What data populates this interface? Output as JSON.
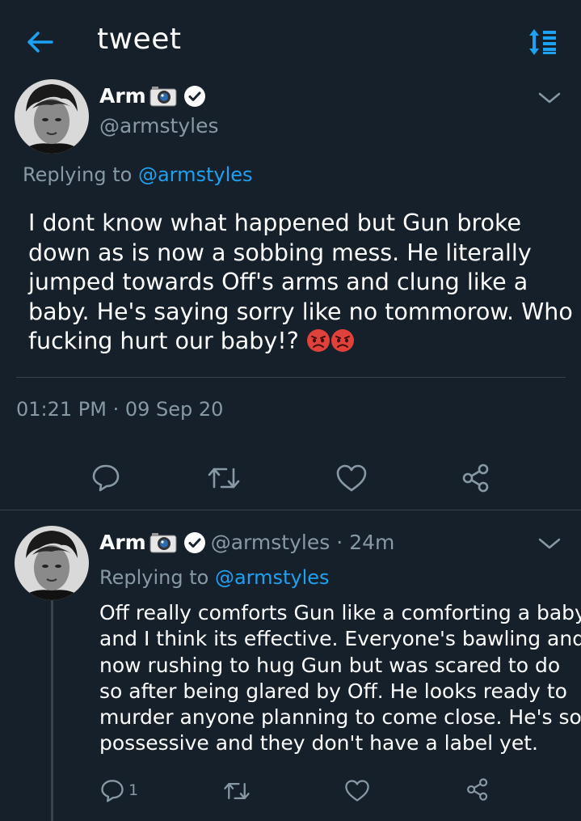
{
  "header": {
    "title": "tweet",
    "back_icon": "arrow-left-icon",
    "sort_icon": "sort-icon"
  },
  "main_tweet": {
    "author_name": "Arm",
    "author_emoji": "camera-icon",
    "handle": "@armstyles",
    "replying_prefix": "Replying to",
    "replying_to": "@armstyles",
    "text_lines": [
      "I dont know what happened but Gun broke",
      "down as is now a sobbing mess. He literally",
      "jumped towards Off's arms and clung like a",
      "baby. He's saying sorry like no tommorow. Who",
      "fucking hurt our baby!? "
    ],
    "trailing_emojis": [
      "angry-face-icon",
      "angry-face-icon"
    ],
    "timestamp": "01:21 PM · 09 Sep 20"
  },
  "reply_tweet": {
    "author_name": "Arm",
    "handle": "@armstyles",
    "separator": "·",
    "time_ago": "24m",
    "replying_prefix": "Replying to",
    "replying_to": "@armstyles",
    "text_lines": [
      "Off really comforts Gun like a comforting a baby",
      "and I think its effective. Everyone's bawling and",
      "now rushing to hug Gun but was scared to do",
      "so after being glared by Off. He looks ready to",
      "murder anyone planning to come close. He's so",
      "possessive and they don't have a label yet."
    ],
    "reply_count": "1"
  },
  "colors": {
    "background": "#15202b",
    "accent": "#1da1f2",
    "secondary_text": "#8899a6",
    "divider": "#38444d"
  }
}
